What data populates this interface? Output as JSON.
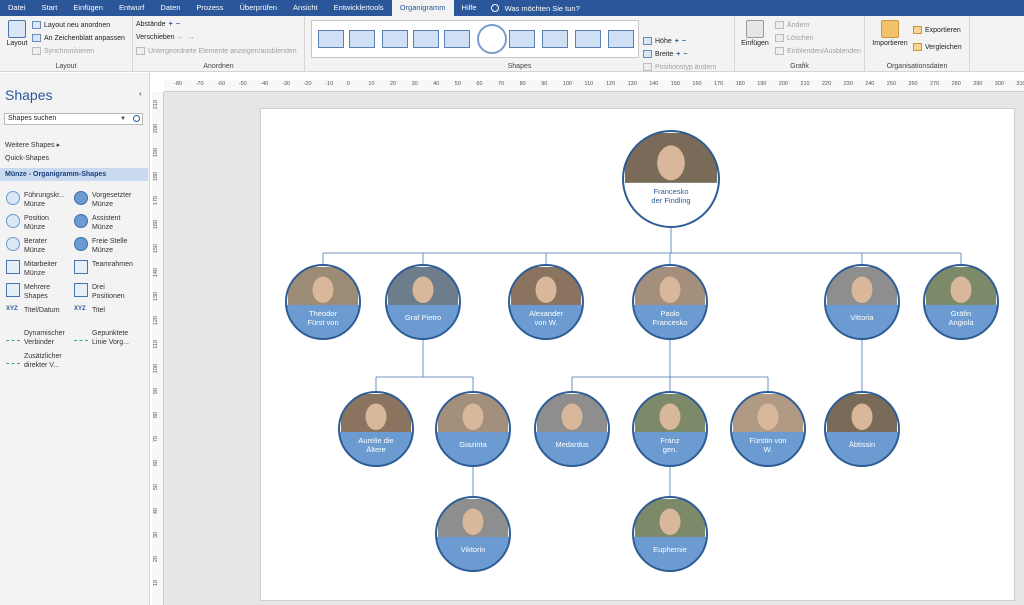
{
  "tabs": [
    "Datei",
    "Start",
    "Einfügen",
    "Entwurf",
    "Daten",
    "Prozess",
    "Überprüfen",
    "Ansicht",
    "Entwicklertools",
    "Organigramm",
    "Hilfe"
  ],
  "active_tab": "Organigramm",
  "tell_me": "Was möchten Sie tun?",
  "ribbon": {
    "layout": {
      "label": "Layout",
      "layout_btn": "Layout",
      "relayout": "Layout neu anordnen",
      "fit_page": "An Zeichenblatt anpassen",
      "sync": "Synchronisieren"
    },
    "arrange": {
      "label": "Anordnen",
      "spacing": "Abstände",
      "move": "Verschieben",
      "show_hide": "Untergeordnete Elemente anzeigen/ausblenden"
    },
    "shapes": {
      "label": "Shapes",
      "height": "Höhe",
      "width": "Breite",
      "position_type": "Positionstyp ändern"
    },
    "graphic": {
      "label": "Grafik",
      "insert": "Einfügen",
      "change": "Ändern",
      "delete": "Löschen",
      "show_hide": "Einblenden/Ausblenden"
    },
    "org_data": {
      "label": "Organisationsdaten",
      "import": "Importieren",
      "export": "Exportieren",
      "compare": "Vergleichen"
    }
  },
  "panel": {
    "title": "Shapes",
    "search_placeholder": "Shapes suchen",
    "more_shapes": "Weitere Shapes",
    "quick_shapes": "Quick-Shapes",
    "category": "Münze - Organigramm-Shapes",
    "shapes": [
      {
        "line1": "Führungskr...",
        "line2": "Münze",
        "icon": "coin"
      },
      {
        "line1": "Vorgesetzter",
        "line2": "Münze",
        "icon": "coin"
      },
      {
        "line1": "Position",
        "line2": "Münze",
        "icon": "coin"
      },
      {
        "line1": "Assistent",
        "line2": "Münze",
        "icon": "coin"
      },
      {
        "line1": "Berater",
        "line2": "Münze",
        "icon": "coin"
      },
      {
        "line1": "Freie Stelle",
        "line2": "Münze",
        "icon": "coin"
      },
      {
        "line1": "Mitarbeiter",
        "line2": "Münze",
        "icon": "box"
      },
      {
        "line1": "Teamrahmen",
        "line2": "",
        "icon": "box"
      },
      {
        "line1": "Mehrere",
        "line2": "Shapes",
        "icon": "box"
      },
      {
        "line1": "Drei",
        "line2": "Positionen",
        "icon": "box"
      },
      {
        "line1": "Titel/Datum",
        "line2": "",
        "icon": "xyz"
      },
      {
        "line1": "Titel",
        "line2": "",
        "icon": "xyz"
      },
      {
        "line1": "Dynamischer",
        "line2": "Verbinder",
        "icon": "line"
      },
      {
        "line1": "Gepunktete",
        "line2": "Linie Vorg...",
        "icon": "line"
      },
      {
        "line1": "Zusätzlicher",
        "line2": "direkter V...",
        "icon": "line"
      }
    ]
  },
  "ruler_top": [
    "-80",
    "-70",
    "-60",
    "-50",
    "-40",
    "-30",
    "-20",
    "-10",
    "0",
    "10",
    "20",
    "30",
    "40",
    "50",
    "60",
    "70",
    "80",
    "90",
    "100",
    "110",
    "120",
    "130",
    "140",
    "150",
    "160",
    "170",
    "180",
    "190",
    "200",
    "210",
    "220",
    "230",
    "240",
    "250",
    "260",
    "270",
    "280",
    "290",
    "300",
    "310"
  ],
  "ruler_left": [
    "210",
    "200",
    "190",
    "180",
    "170",
    "160",
    "150",
    "140",
    "130",
    "120",
    "110",
    "100",
    "90",
    "80",
    "70",
    "60",
    "50",
    "40",
    "30",
    "20",
    "10"
  ],
  "org": {
    "root": {
      "line1": "Francesko",
      "line2": "der Findling"
    },
    "level1": [
      {
        "line1": "Theodor",
        "line2": "Fürst von"
      },
      {
        "line1": "Graf Pietro",
        "line2": ""
      },
      {
        "line1": "Alexander",
        "line2": "von W."
      },
      {
        "line1": "Paolo",
        "line2": "Francesko"
      },
      {
        "line1": "Vittoria",
        "line2": ""
      },
      {
        "line1": "Gräfin",
        "line2": "Angiola"
      }
    ],
    "level2": [
      {
        "line1": "Aurelie die",
        "line2": "Ältere"
      },
      {
        "line1": "Giazinta",
        "line2": ""
      },
      {
        "line1": "Medardus",
        "line2": ""
      },
      {
        "line1": "Franz",
        "line2": "gen."
      },
      {
        "line1": "Fürstin von",
        "line2": "W."
      },
      {
        "line1": "Äbtissin",
        "line2": ""
      }
    ],
    "level3": [
      {
        "line1": "Viktorin",
        "line2": ""
      },
      {
        "line1": "Euphemie",
        "line2": ""
      }
    ]
  }
}
